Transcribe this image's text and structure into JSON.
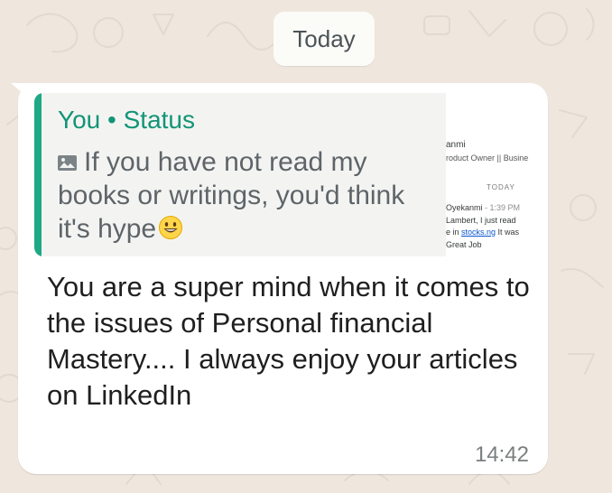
{
  "chat": {
    "date_separator": "Today",
    "message": {
      "quote": {
        "author": "You • Status",
        "media_icon": "image-icon",
        "text": "If you have not read my books or writings, you'd think it's hype",
        "emoji": "grinning-face-icon",
        "thumbnail": {
          "name": "anmi",
          "title": "roduct Owner || Busine",
          "today": "TODAY",
          "sender": "Oyekanmi",
          "time": "- 1:39 PM",
          "line1": "Lambert, I just read",
          "line2_prefix": "e in ",
          "line2_link": "stocks.ng",
          "line2_suffix": " It was",
          "line3": "Great Job"
        }
      },
      "body": "You are a super mind when it comes to the issues of Personal financial Mastery.... I always enjoy your articles on LinkedIn",
      "time": "14:42"
    }
  },
  "colors": {
    "background": "#efe7dd",
    "bubble": "#ffffff",
    "quote_background": "#f3f4f2",
    "accent": "#1fa884",
    "timestamp": "#7b7f80"
  }
}
